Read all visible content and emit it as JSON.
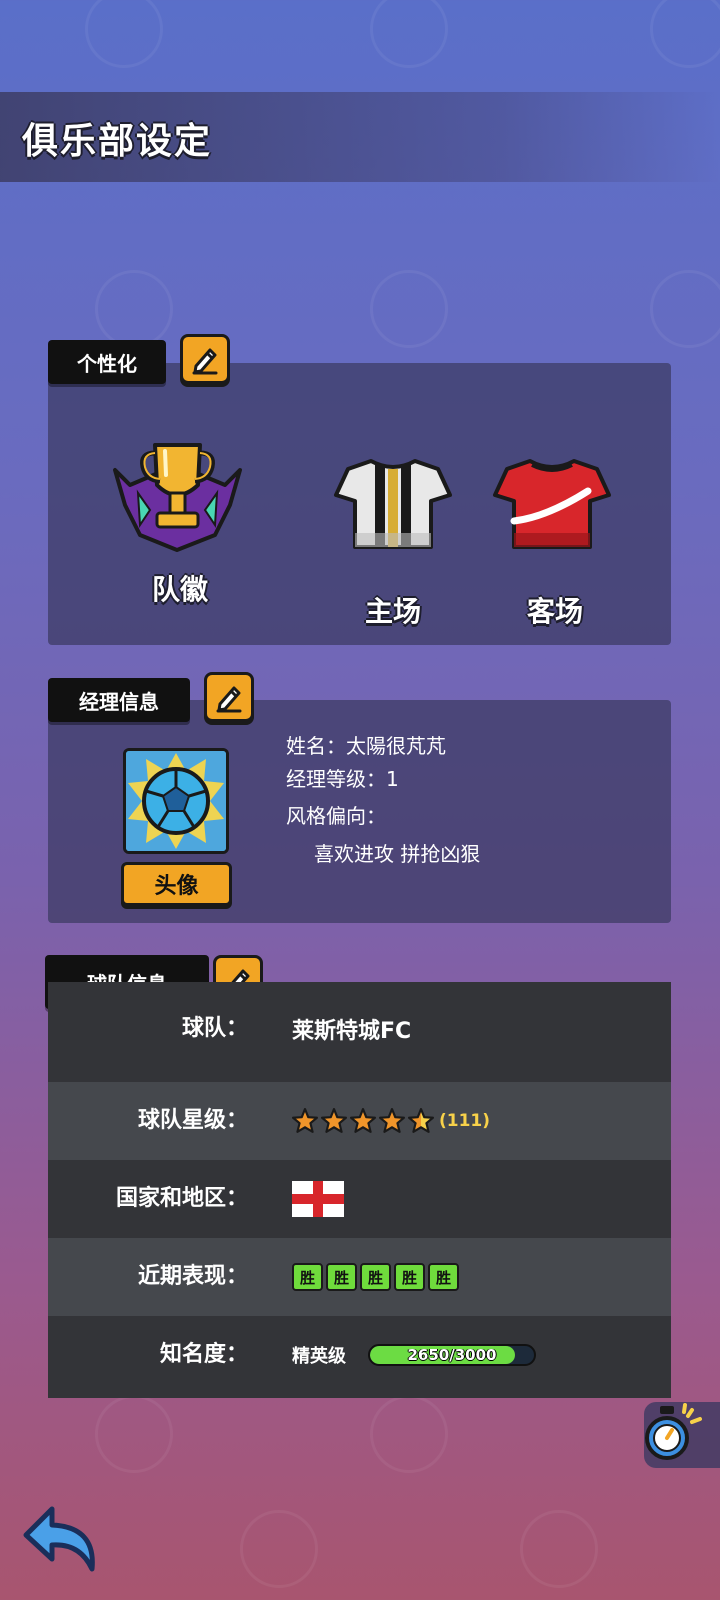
{
  "header": {
    "title": "俱乐部设定"
  },
  "personalization": {
    "tag_label": "个性化",
    "badge_label": "队徽",
    "home_label": "主场",
    "away_label": "客场"
  },
  "manager": {
    "tag_label": "经理信息",
    "name_line": "姓名：太陽很芃芃",
    "level_line": "经理等级：1",
    "style_label": "风格偏向：",
    "style_value": "喜欢进攻 拼抢凶狠",
    "avatar_button": "头像"
  },
  "team": {
    "tag_label": "球队信息",
    "rows": {
      "name": {
        "label": "球队：",
        "value": "莱斯特城FC"
      },
      "stars": {
        "label": "球队星级：",
        "value": "(111)",
        "rating": 4.5,
        "max": 5
      },
      "country": {
        "label": "国家和地区：",
        "flag": "england-flag"
      },
      "form": {
        "label": "近期表现：",
        "results": [
          "胜",
          "胜",
          "胜",
          "胜",
          "胜"
        ]
      },
      "fame": {
        "label": "知名度：",
        "tier": "精英级",
        "progress_text": "2650/3000",
        "progress": 0.8833
      }
    }
  },
  "colors": {
    "accent": "#f2a524",
    "win": "#6fdc3c",
    "home_kit": "#e8e8e8",
    "away_kit": "#d8262b"
  }
}
